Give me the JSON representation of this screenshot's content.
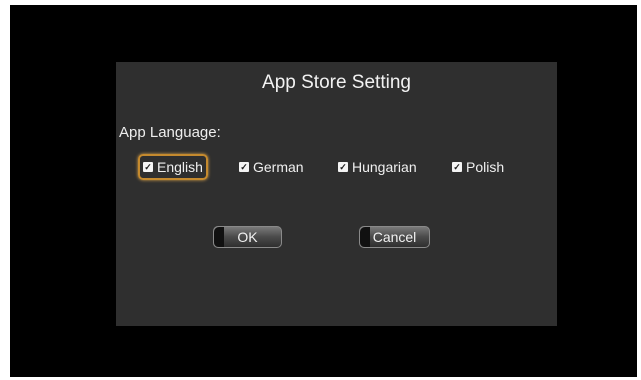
{
  "dialog": {
    "title": "App Store Setting",
    "language_label": "App Language:",
    "options": [
      {
        "label": "English",
        "checked": true,
        "focused": true
      },
      {
        "label": "German",
        "checked": true
      },
      {
        "label": "Hungarian",
        "checked": true
      },
      {
        "label": "Polish",
        "checked": true
      }
    ],
    "ok_label": "OK",
    "cancel_label": "Cancel"
  },
  "colors": {
    "dialog_bg": "#2f2f2f",
    "focus_border": "#c58a2e"
  }
}
